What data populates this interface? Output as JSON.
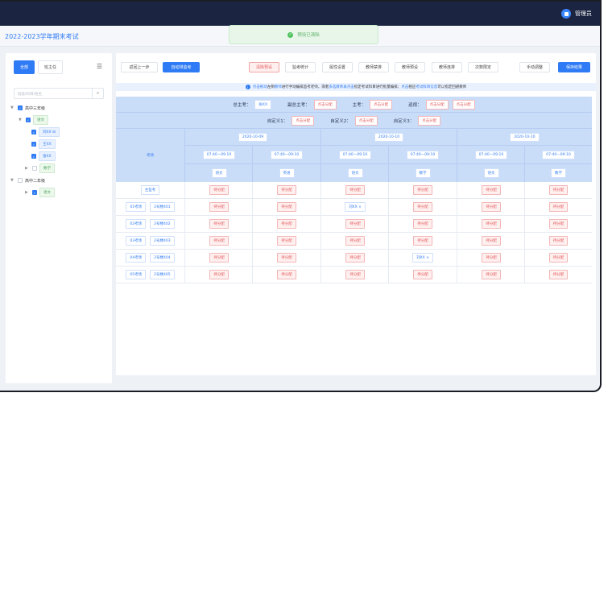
{
  "header": {
    "user_name": "管理员"
  },
  "title": {
    "exam_name": "2022-2023学年期末考试"
  },
  "toast": {
    "message": "预设已清除"
  },
  "sidebar": {
    "segments": [
      {
        "label": "全部",
        "active": true
      },
      {
        "label": "班主任",
        "active": false
      }
    ],
    "search_placeholder": "班级/科目/姓名",
    "tree": [
      {
        "label": "高中三年级",
        "level": 0,
        "checked": true,
        "expanded": true,
        "type": "text"
      },
      {
        "label": "语文",
        "level": 1,
        "checked": true,
        "expanded": true,
        "type": "subject"
      },
      {
        "label": "刘XX",
        "level": 2,
        "checked": true,
        "type": "teacher",
        "suffix": "⊟"
      },
      {
        "label": "王XX",
        "level": 2,
        "checked": true,
        "type": "teacher"
      },
      {
        "label": "张XX",
        "level": 2,
        "checked": true,
        "type": "teacher"
      },
      {
        "label": "数学",
        "level": 1,
        "checked": false,
        "expanded": false,
        "type": "subject"
      },
      {
        "label": "高中二年级",
        "level": 0,
        "checked": false,
        "expanded": true,
        "type": "text"
      },
      {
        "label": "语文",
        "level": 1,
        "checked": true,
        "expanded": false,
        "type": "subject"
      }
    ]
  },
  "toolbar": {
    "back": "返回上一步",
    "auto": "自动排监考",
    "clear": "清除预设",
    "stats": "监考统计",
    "attr": "属性设置",
    "ban": "教师禁排",
    "preset": "教师预设",
    "link": "教师连排",
    "limit": "次数限定",
    "manual": "手动调整",
    "save": "保存结果"
  },
  "hint": {
    "a": "点击拖动",
    "b": "左侧",
    "c": "教师",
    "d": "进行手动编排监考老师，或者",
    "e": "多选教师再点击",
    "f": "指定考试科目进行批量编排；",
    "g": "点击",
    "h": "相应",
    "i": "考试科目信息",
    "j": "可以指定回避教师"
  },
  "top_roles": {
    "chief_label": "总主考：",
    "chief_value": "张XX",
    "vice_label": "副总主考：",
    "main_label": "主考：",
    "patrol_label": "巡视：",
    "custom1_label": "自定义1：",
    "custom2_label": "自定义2：",
    "custom3_label": "自定义3：",
    "assign": "点击分配"
  },
  "table": {
    "room_header": "考场",
    "dates": [
      "2020-10-09",
      "2020-10-09",
      "2020-10-10",
      "2020-10-10",
      "2020-10-10",
      "2020-10-10"
    ],
    "date_groups": [
      "2020-10-09",
      "2020-10-10",
      "2020-10-10"
    ],
    "times": [
      "07:40—09:10",
      "07:40—09:10",
      "07:40—09:10",
      "07:40—09:10",
      "07:40—09:10",
      "07:40—09:10"
    ],
    "subjects": [
      "语文",
      "英语",
      "语文",
      "数学",
      "语文",
      "数学"
    ],
    "pending": "待分配",
    "chief_row_label": "主监考",
    "rooms": [
      {
        "name": "01考场",
        "loc": "2号楼401",
        "cells": [
          "待分配",
          "待分配",
          "刘XX ×",
          "待分配",
          "待分配",
          "待分配"
        ]
      },
      {
        "name": "02考场",
        "loc": "2号楼402",
        "cells": [
          "待分配",
          "待分配",
          "待分配",
          "待分配",
          "待分配",
          "待分配"
        ]
      },
      {
        "name": "03考场",
        "loc": "2号楼403",
        "cells": [
          "待分配",
          "待分配",
          "待分配",
          "待分配",
          "待分配",
          "待分配"
        ]
      },
      {
        "name": "04考场",
        "loc": "2号楼404",
        "cells": [
          "待分配",
          "待分配",
          "待分配",
          "刘XX ×",
          "待分配",
          "待分配"
        ]
      },
      {
        "name": "05考场",
        "loc": "2号楼405",
        "cells": [
          "待分配",
          "待分配",
          "待分配",
          "待分配",
          "待分配",
          "待分配"
        ]
      }
    ]
  }
}
